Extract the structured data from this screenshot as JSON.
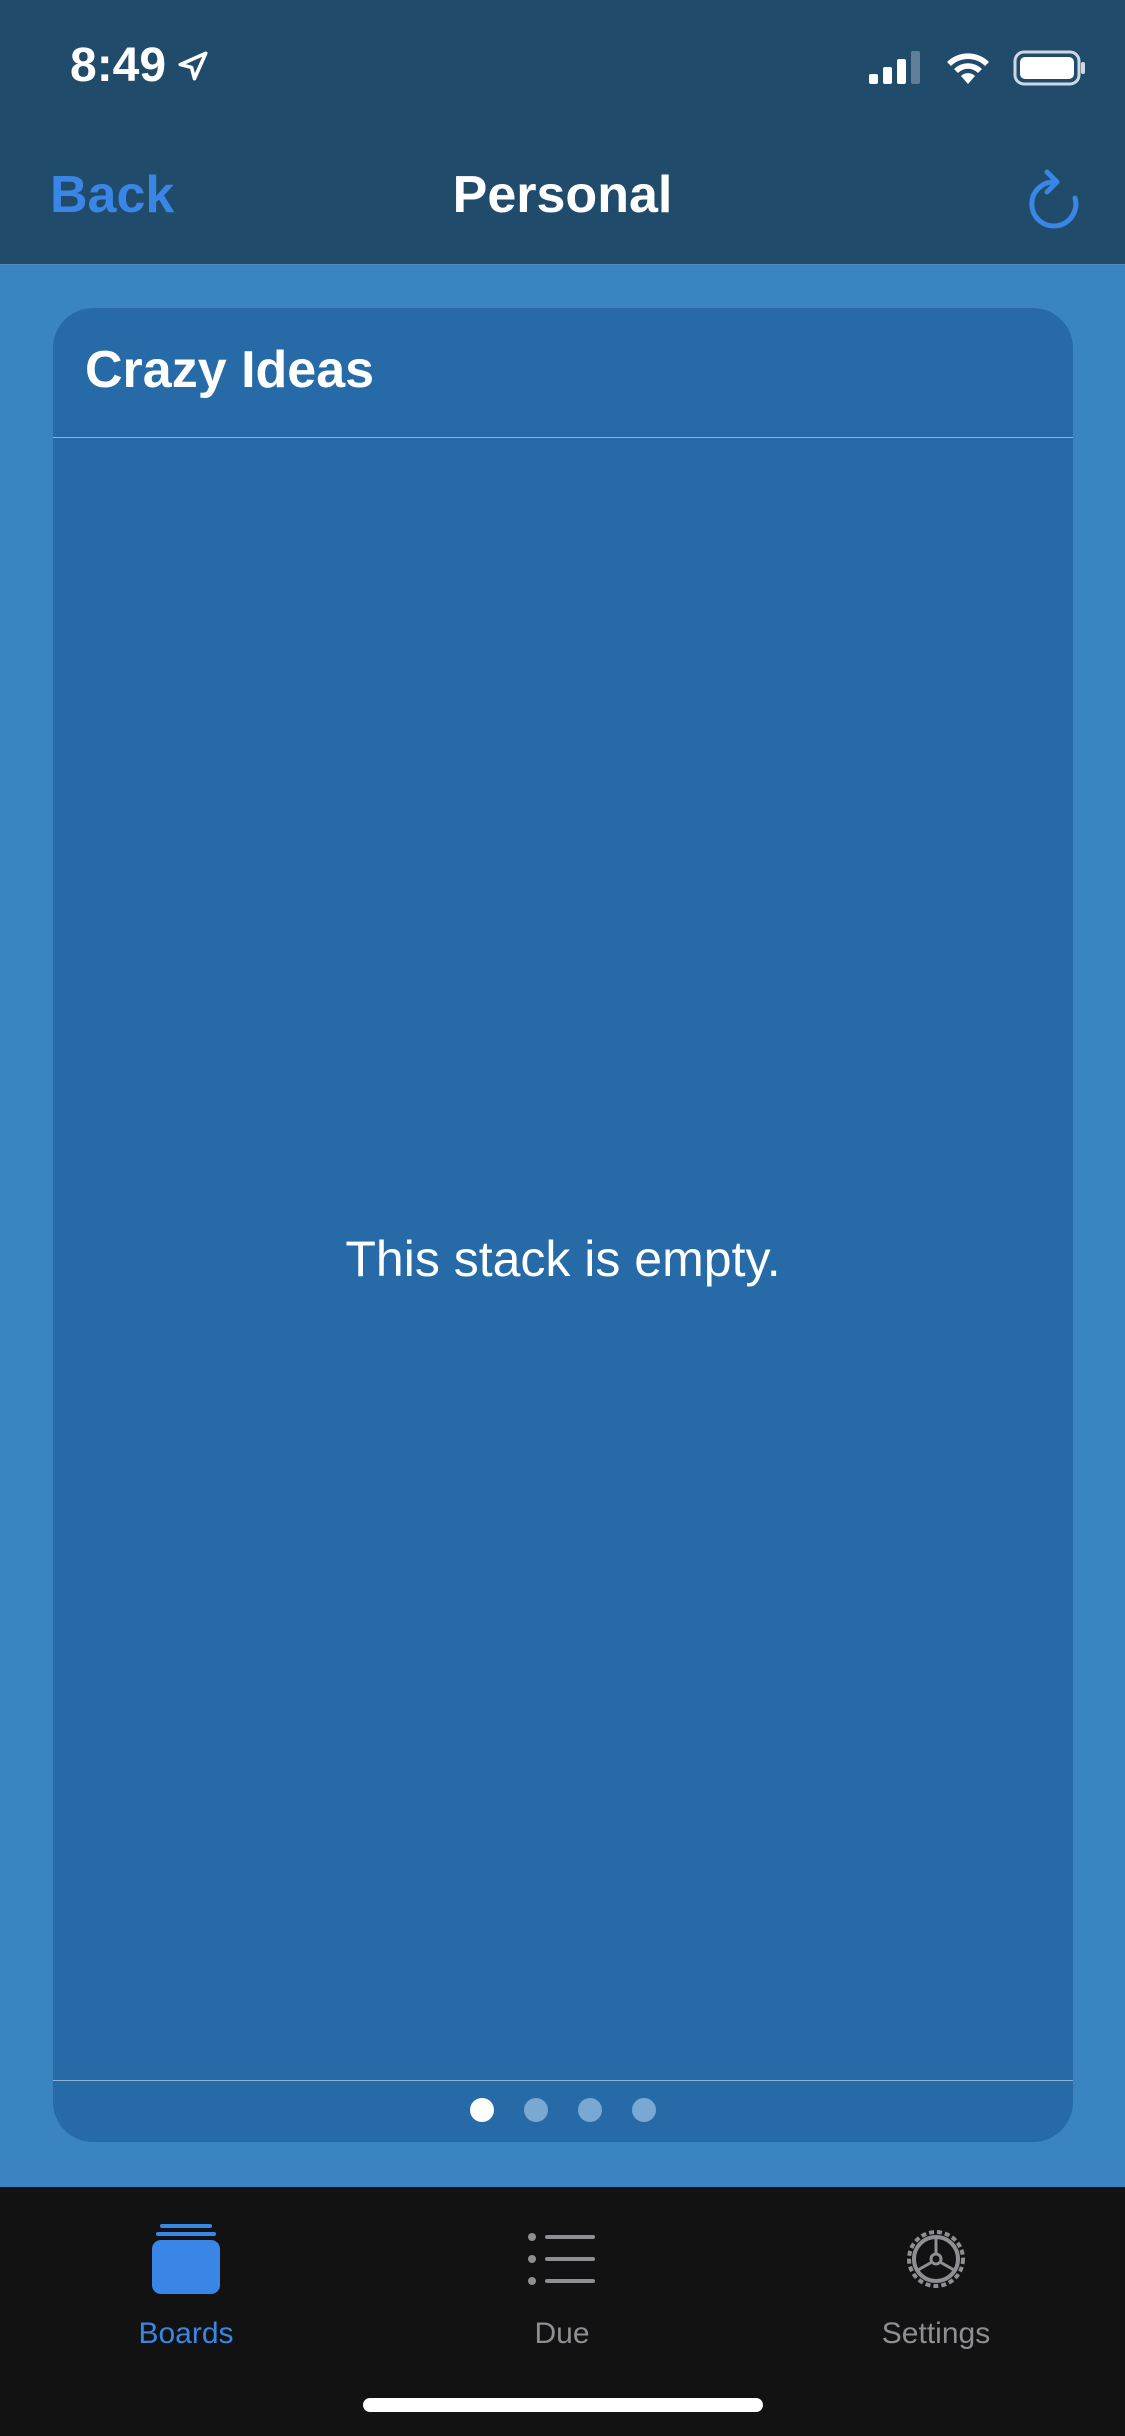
{
  "status": {
    "time": "8:49"
  },
  "nav": {
    "back_label": "Back",
    "title": "Personal"
  },
  "card": {
    "title": "Crazy Ideas",
    "empty_message": "This stack is empty."
  },
  "pager": {
    "count": 4,
    "active_index": 0
  },
  "tabs": [
    {
      "label": "Boards",
      "icon": "boards-icon",
      "active": true
    },
    {
      "label": "Due",
      "icon": "list-icon",
      "active": false
    },
    {
      "label": "Settings",
      "icon": "gear-icon",
      "active": false
    }
  ],
  "colors": {
    "accent": "#3a86e6",
    "nav_background": "#214b6b",
    "page_background": "#3b84c2",
    "card_background": "#266ba7",
    "tabbar_background": "#121212",
    "inactive_tab": "#8e8e93"
  }
}
